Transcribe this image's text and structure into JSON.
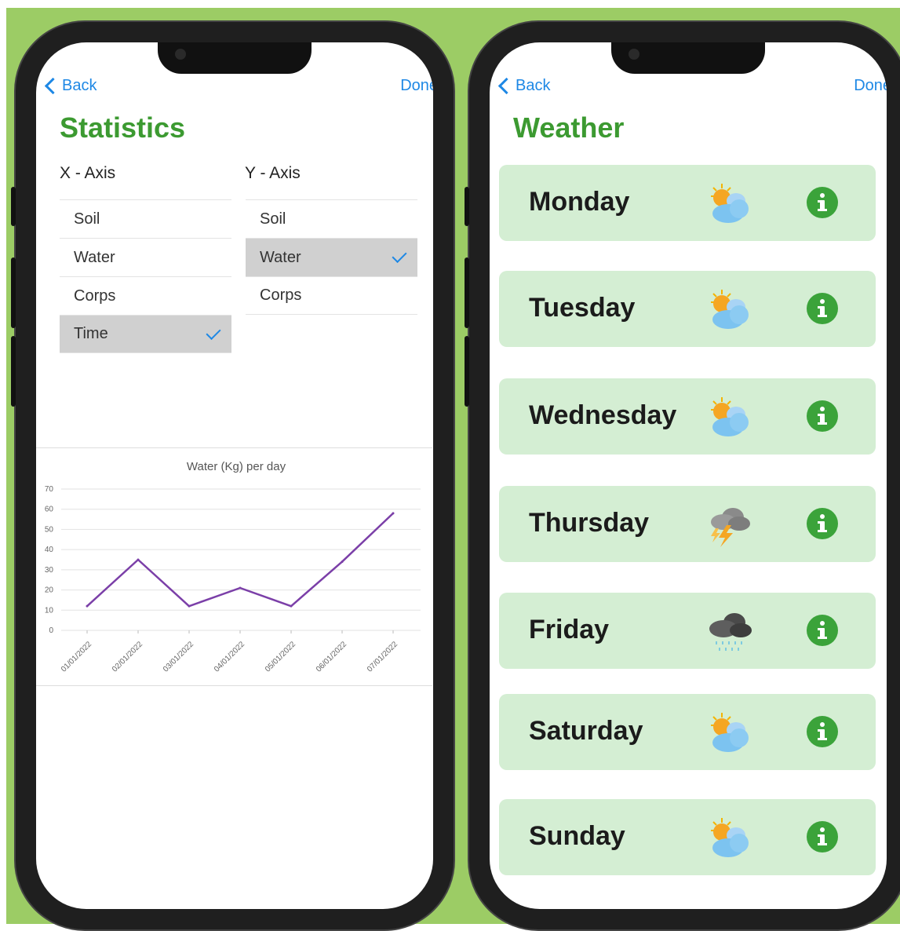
{
  "stats_screen": {
    "back_label": "Back",
    "done_label": "Done",
    "title": "Statistics",
    "x_axis_label": "X - Axis",
    "y_axis_label": "Y - Axis",
    "x_options": [
      {
        "label": "Soil",
        "selected": false
      },
      {
        "label": "Water",
        "selected": false
      },
      {
        "label": "Corps",
        "selected": false
      },
      {
        "label": "Time",
        "selected": true
      }
    ],
    "y_options": [
      {
        "label": "Soil",
        "selected": false
      },
      {
        "label": "Water",
        "selected": true
      },
      {
        "label": "Corps",
        "selected": false
      }
    ]
  },
  "chart_data": {
    "type": "line",
    "title": "Water (Kg) per day",
    "xlabel": "",
    "ylabel": "",
    "categories": [
      "01/01/2022",
      "02/01/2022",
      "03/01/2022",
      "04/01/2022",
      "05/01/2022",
      "06/01/2022",
      "07/01/2022"
    ],
    "series": [
      {
        "values": [
          12,
          35,
          12,
          21,
          12,
          34,
          58
        ],
        "color": "#7b3fa8"
      }
    ],
    "ylim": [
      0,
      70
    ],
    "yticks": [
      0,
      10,
      20,
      30,
      40,
      50,
      60,
      70
    ],
    "grid": true
  },
  "weather_screen": {
    "back_label": "Back",
    "done_label": "Done",
    "title": "Weather",
    "days": [
      {
        "name": "Monday",
        "icon": "partly-cloudy-icon"
      },
      {
        "name": "Tuesday",
        "icon": "partly-cloudy-icon"
      },
      {
        "name": "Wednesday",
        "icon": "partly-cloudy-icon"
      },
      {
        "name": "Thursday",
        "icon": "thunderstorm-icon"
      },
      {
        "name": "Friday",
        "icon": "rain-cloud-icon"
      },
      {
        "name": "Saturday",
        "icon": "partly-cloudy-icon"
      },
      {
        "name": "Sunday",
        "icon": "partly-cloudy-icon"
      }
    ]
  },
  "colors": {
    "background": "#9ccc65",
    "title_green": "#3c9a31",
    "link_blue": "#1e88e5",
    "card_green": "#d4eed3",
    "info_green": "#3ba33a",
    "line_purple": "#7b3fa8",
    "selected_gray": "#d0d0d0"
  }
}
